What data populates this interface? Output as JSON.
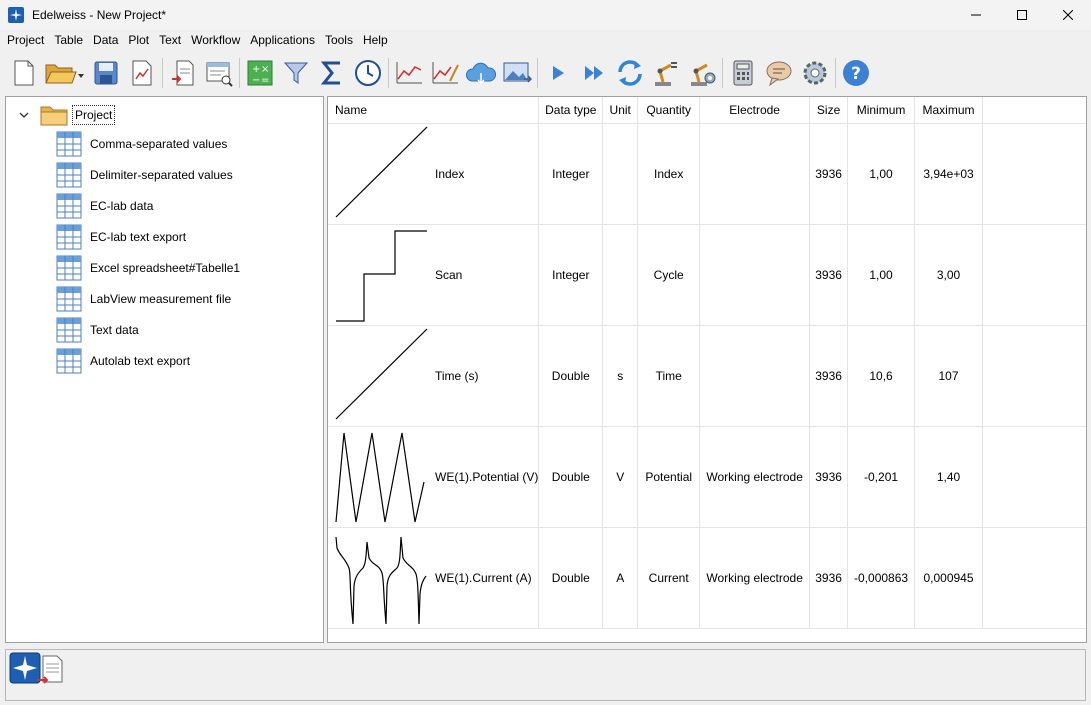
{
  "window": {
    "title": "Edelweiss - New Project*"
  },
  "menu": [
    "Project",
    "Table",
    "Data",
    "Plot",
    "Text",
    "Workflow",
    "Applications",
    "Tools",
    "Help"
  ],
  "toolbar": {
    "icons": [
      "new-file-icon",
      "open-folder-icon",
      "save-icon",
      "export-plot-icon",
      "import-icon",
      "preview-icon",
      "calculator-table-icon",
      "filter-icon",
      "sum-icon",
      "clock-icon",
      "line-chart-icon",
      "line-chart-edit-icon",
      "cloud-icon",
      "image-icon",
      "play-icon",
      "fast-forward-icon",
      "refresh-icon",
      "robot-arm-icon",
      "robot-arm-settings-icon",
      "calculator-icon",
      "chat-icon",
      "gear-icon",
      "help-icon"
    ]
  },
  "tree": {
    "root": "Project",
    "items": [
      "Comma-separated values",
      "Delimiter-separated values",
      "EC-lab data",
      "EC-lab text export",
      "Excel spreadsheet#Tabelle1",
      "LabView measurement file",
      "Text data",
      "Autolab text export"
    ]
  },
  "table": {
    "headers": [
      "Name",
      "Data type",
      "Unit",
      "Quantity",
      "Electrode",
      "Size",
      "Minimum",
      "Maximum"
    ],
    "rows": [
      {
        "name": "Index",
        "type": "Integer",
        "unit": "",
        "quantity": "Index",
        "electrode": "",
        "size": "3936",
        "min": "1,00",
        "max": "3,94e+03",
        "thumb": "ramp"
      },
      {
        "name": "Scan",
        "type": "Integer",
        "unit": "",
        "quantity": "Cycle",
        "electrode": "",
        "size": "3936",
        "min": "1,00",
        "max": "3,00",
        "thumb": "steps"
      },
      {
        "name": "Time (s)",
        "type": "Double",
        "unit": "s",
        "quantity": "Time",
        "electrode": "",
        "size": "3936",
        "min": "10,6",
        "max": "107",
        "thumb": "ramp"
      },
      {
        "name": "WE(1).Potential (V)",
        "type": "Double",
        "unit": "V",
        "quantity": "Potential",
        "electrode": "Working electrode",
        "size": "3936",
        "min": "-0,201",
        "max": "1,40",
        "thumb": "triangle"
      },
      {
        "name": "WE(1).Current (A)",
        "type": "Double",
        "unit": "A",
        "quantity": "Current",
        "electrode": "Working electrode",
        "size": "3936",
        "min": "-0,000863",
        "max": "0,000945",
        "thumb": "current"
      }
    ]
  },
  "colors": {
    "accent": "#1c7cd5",
    "folder": "#f2c46d",
    "table_icon": "#6a9fd8"
  }
}
